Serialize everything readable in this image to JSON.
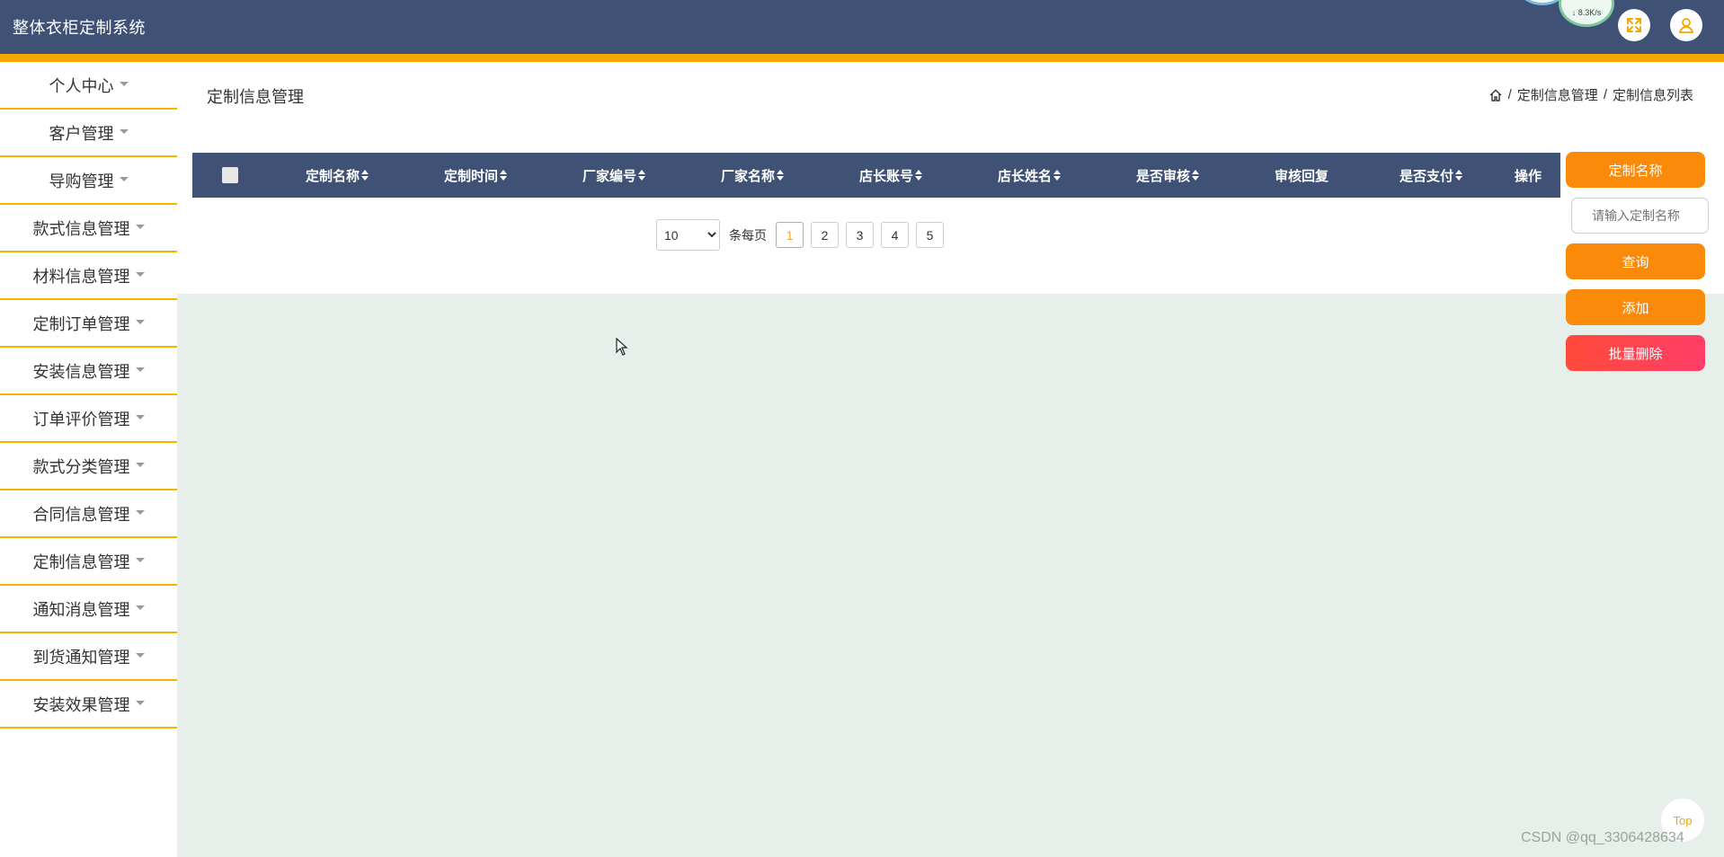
{
  "header": {
    "app_title": "整体衣柜定制系统",
    "net_speed": "↓ 8.3K/s",
    "fullscreen_icon": "expand-icon",
    "user_icon": "user-icon"
  },
  "sidebar": {
    "items": [
      {
        "label": "个人中心"
      },
      {
        "label": "客户管理"
      },
      {
        "label": "导购管理"
      },
      {
        "label": "款式信息管理"
      },
      {
        "label": "材料信息管理"
      },
      {
        "label": "定制订单管理"
      },
      {
        "label": "安装信息管理"
      },
      {
        "label": "订单评价管理"
      },
      {
        "label": "款式分类管理"
      },
      {
        "label": "合同信息管理"
      },
      {
        "label": "定制信息管理"
      },
      {
        "label": "通知消息管理"
      },
      {
        "label": "到货通知管理"
      },
      {
        "label": "安装效果管理"
      }
    ]
  },
  "main": {
    "page_title": "定制信息管理",
    "breadcrumb": {
      "home_icon": "home-icon",
      "separator": "/",
      "level1": "定制信息管理",
      "level2": "定制信息列表"
    },
    "table": {
      "columns": [
        {
          "label": "定制名称",
          "sortable": true
        },
        {
          "label": "定制时间",
          "sortable": true
        },
        {
          "label": "厂家编号",
          "sortable": true
        },
        {
          "label": "厂家名称",
          "sortable": true
        },
        {
          "label": "店长账号",
          "sortable": true
        },
        {
          "label": "店长姓名",
          "sortable": true
        },
        {
          "label": "是否审核",
          "sortable": true
        },
        {
          "label": "审核回复",
          "sortable": false
        },
        {
          "label": "是否支付",
          "sortable": true
        },
        {
          "label": "操作",
          "sortable": false
        }
      ],
      "rows": []
    },
    "pagination": {
      "page_size": "10",
      "page_size_options": [
        "10"
      ],
      "per_page_label": "条每页",
      "pages": [
        "1",
        "2",
        "3",
        "4",
        "5"
      ],
      "current_page": "1"
    }
  },
  "actions": {
    "field_label": "定制名称",
    "search_placeholder": "请输入定制名称",
    "query_label": "查询",
    "add_label": "添加",
    "batch_delete_label": "批量删除"
  },
  "misc": {
    "top_label": "Top",
    "watermark": "CSDN @qq_3306428634"
  },
  "colors": {
    "header_bg": "#3f5276",
    "accent": "#f7a800",
    "button_orange": "#f98a0a",
    "danger": "#ff4458",
    "content_bg": "#e6efea"
  }
}
